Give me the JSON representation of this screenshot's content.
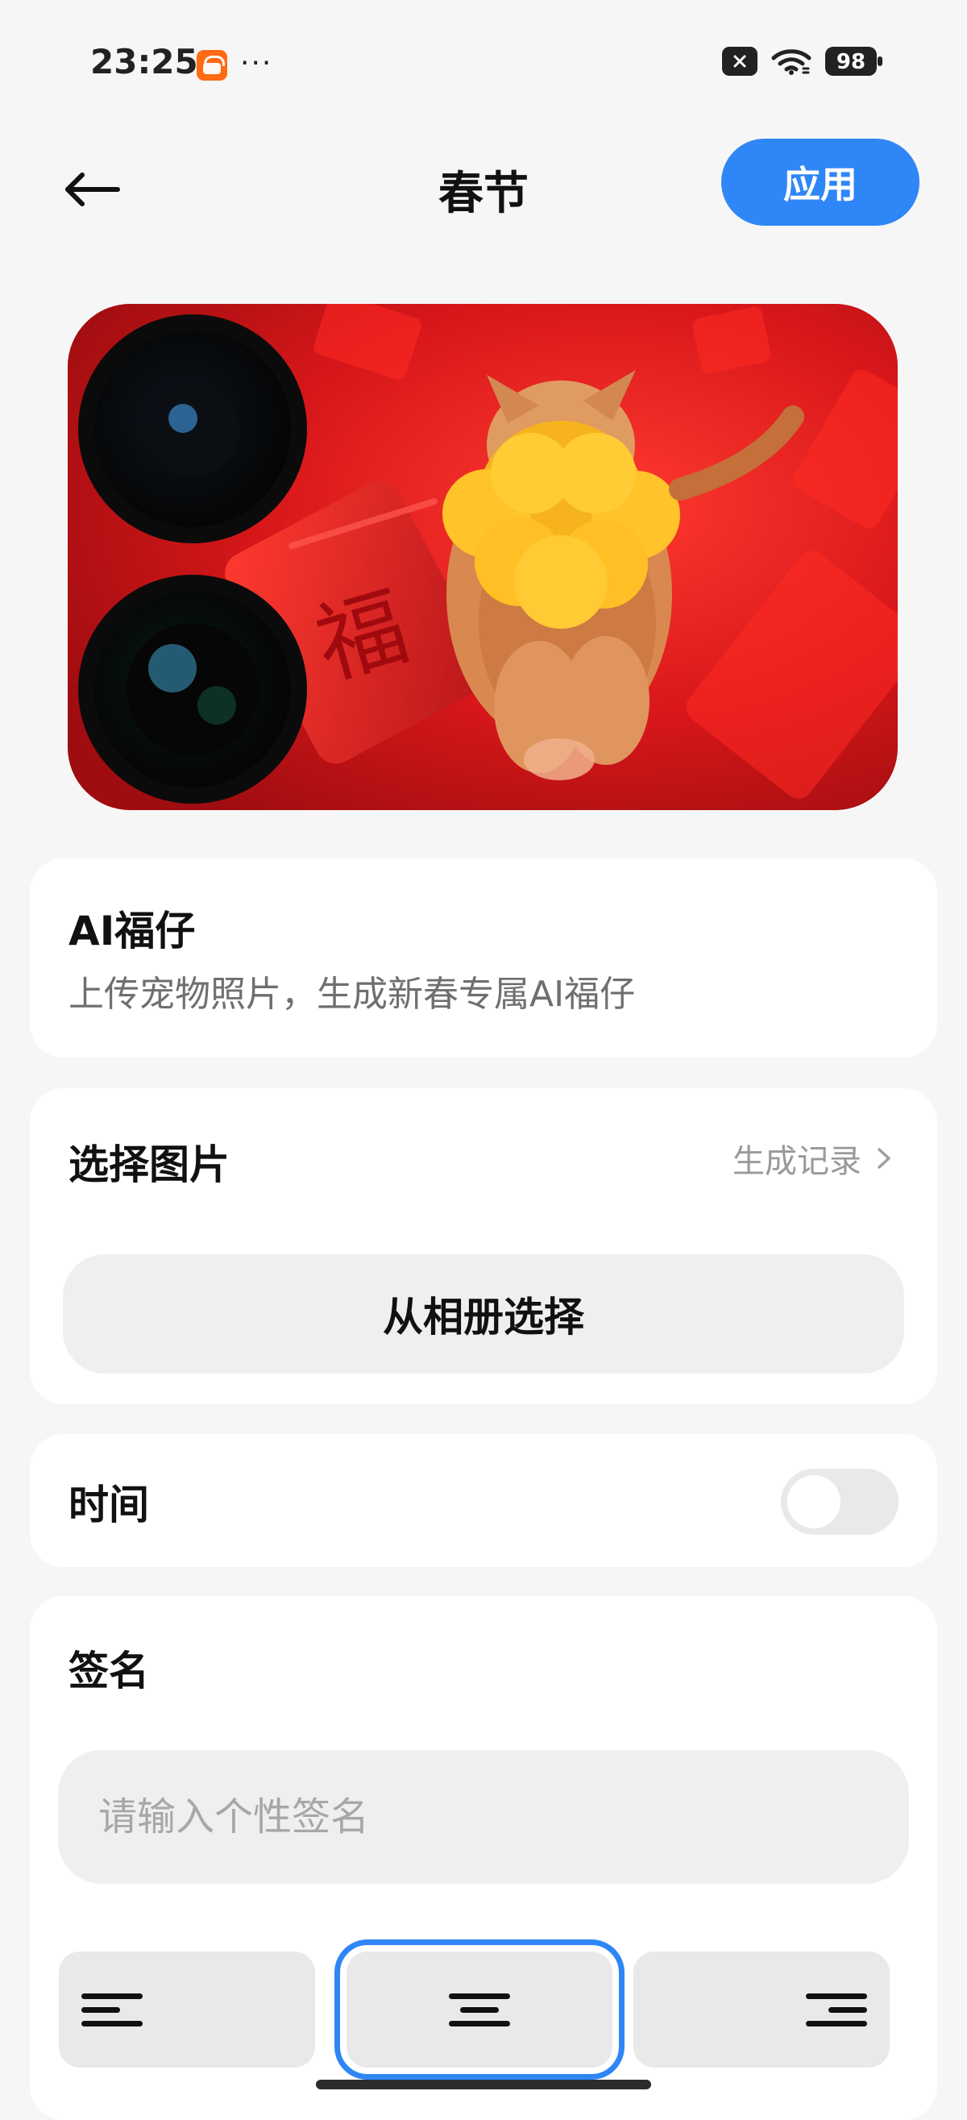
{
  "status_bar": {
    "time": "23:25",
    "more": "···",
    "battery": "98"
  },
  "header": {
    "title": "春节",
    "apply_label": "应用"
  },
  "ai_section": {
    "title": "AI福仔",
    "description": "上传宠物照片，生成新春专属AI福仔"
  },
  "select_image": {
    "title": "选择图片",
    "history_label": "生成记录",
    "album_button": "从相册选择"
  },
  "time_section": {
    "label": "时间",
    "enabled": false
  },
  "signature": {
    "title": "签名",
    "placeholder": "请输入个性签名",
    "value": "",
    "alignment_selected": "center"
  },
  "colors": {
    "accent": "#2f86f6",
    "background": "#f6f6f6",
    "card": "#ffffff",
    "preview_red": "#c51a16"
  }
}
